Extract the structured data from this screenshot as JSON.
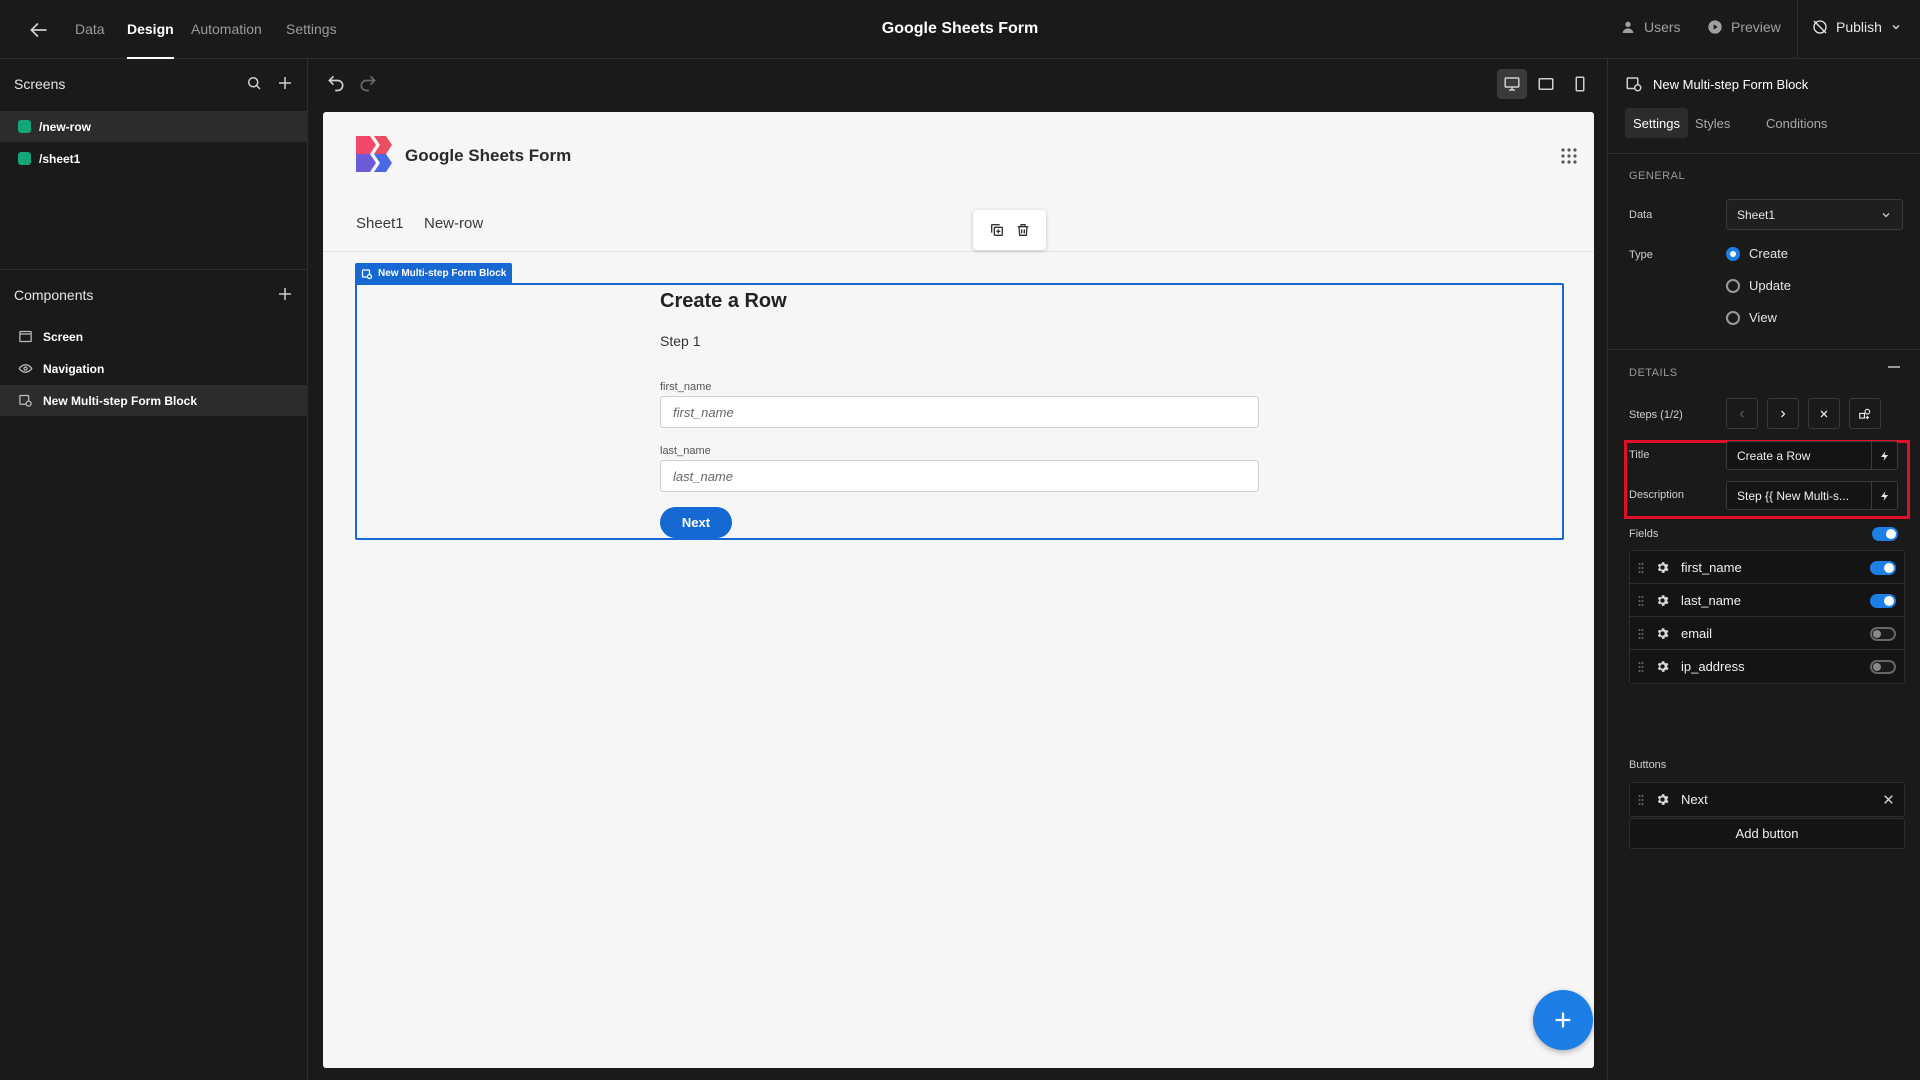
{
  "topbar": {
    "tabs": [
      {
        "label": "Data"
      },
      {
        "label": "Design"
      },
      {
        "label": "Automation"
      },
      {
        "label": "Settings"
      }
    ],
    "app_title": "Google Sheets Form",
    "users_label": "Users",
    "preview_label": "Preview",
    "publish_label": "Publish"
  },
  "left": {
    "screens_title": "Screens",
    "screens": [
      {
        "label": "/new-row"
      },
      {
        "label": "/sheet1"
      }
    ],
    "components_title": "Components",
    "components": [
      {
        "label": "Screen"
      },
      {
        "label": "Navigation"
      },
      {
        "label": "New Multi-step Form Block"
      }
    ]
  },
  "preview": {
    "title": "Google Sheets Form",
    "nav": [
      {
        "label": "Sheet1"
      },
      {
        "label": "New-row"
      }
    ],
    "block_tag": "New Multi-step Form Block",
    "form": {
      "title": "Create a Row",
      "step": "Step 1",
      "fields": [
        {
          "label": "first_name",
          "placeholder": "first_name"
        },
        {
          "label": "last_name",
          "placeholder": "last_name"
        }
      ],
      "next_label": "Next"
    }
  },
  "right": {
    "title": "New Multi-step Form Block",
    "tabs": [
      {
        "label": "Settings"
      },
      {
        "label": "Styles"
      },
      {
        "label": "Conditions"
      }
    ],
    "general_label": "GENERAL",
    "data_label": "Data",
    "data_value": "Sheet1",
    "type_label": "Type",
    "type_options": [
      {
        "label": "Create",
        "selected": true
      },
      {
        "label": "Update",
        "selected": false
      },
      {
        "label": "View",
        "selected": false
      }
    ],
    "details_label": "DETAILS",
    "steps_label": "Steps (1/2)",
    "title_label": "Title",
    "title_value": "Create a Row",
    "description_label": "Description",
    "description_value": "Step {{ New Multi-s...",
    "fields_label": "Fields",
    "fields": [
      {
        "label": "first_name",
        "enabled": true
      },
      {
        "label": "last_name",
        "enabled": true
      },
      {
        "label": "email",
        "enabled": false
      },
      {
        "label": "ip_address",
        "enabled": false
      }
    ],
    "buttons_label": "Buttons",
    "buttons": [
      {
        "label": "Next"
      }
    ],
    "add_button_label": "Add button"
  },
  "colors": {
    "accent": "#1668d3",
    "highlight": "#e0102a",
    "screen_dot": "#12a679"
  }
}
